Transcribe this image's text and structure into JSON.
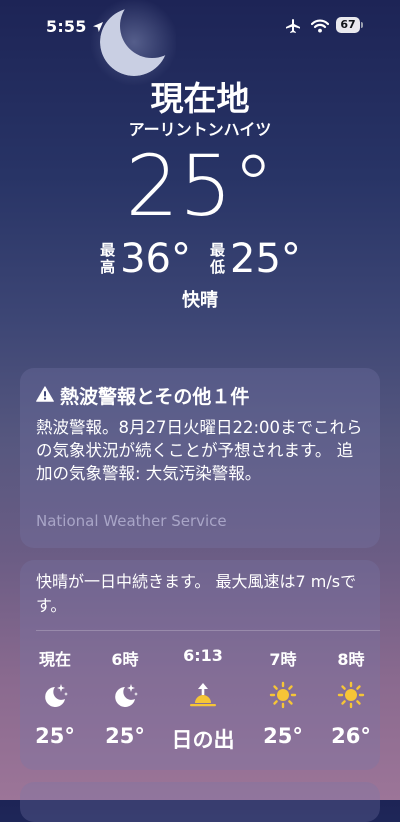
{
  "status_bar": {
    "time": "5:55",
    "battery": "67"
  },
  "header": {
    "title": "現在地",
    "place": "アーリントンハイツ",
    "current_temp": "25°",
    "high_label": "最\n高",
    "high_temp": "36°",
    "low_label": "最\n低",
    "low_temp": "25°",
    "condition": "快晴"
  },
  "alert": {
    "title": "熱波警報とその他１件",
    "body": "熱波警報。8月27日火曜日22:00までこれらの気象状況が続くことが予想されます。 追加の気象警報: 大気汚染警報。",
    "source": "National Weather Service"
  },
  "forecast": {
    "summary": "快晴が一日中続きます。 最大風速は7 m/sです。",
    "hours": [
      {
        "label": "現在",
        "icon": "moon-stars-icon",
        "temp": "25°"
      },
      {
        "label": "6時",
        "icon": "moon-stars-icon",
        "temp": "25°"
      },
      {
        "label": "6:13",
        "icon": "sunrise-icon",
        "temp": "日の出"
      },
      {
        "label": "7時",
        "icon": "sun-icon",
        "temp": "25°"
      },
      {
        "label": "8時",
        "icon": "sun-icon",
        "temp": "26°"
      }
    ]
  },
  "colors": {
    "sun": "#f6c537",
    "background_top": "#1d2456",
    "background_bottom": "#9c7598"
  }
}
